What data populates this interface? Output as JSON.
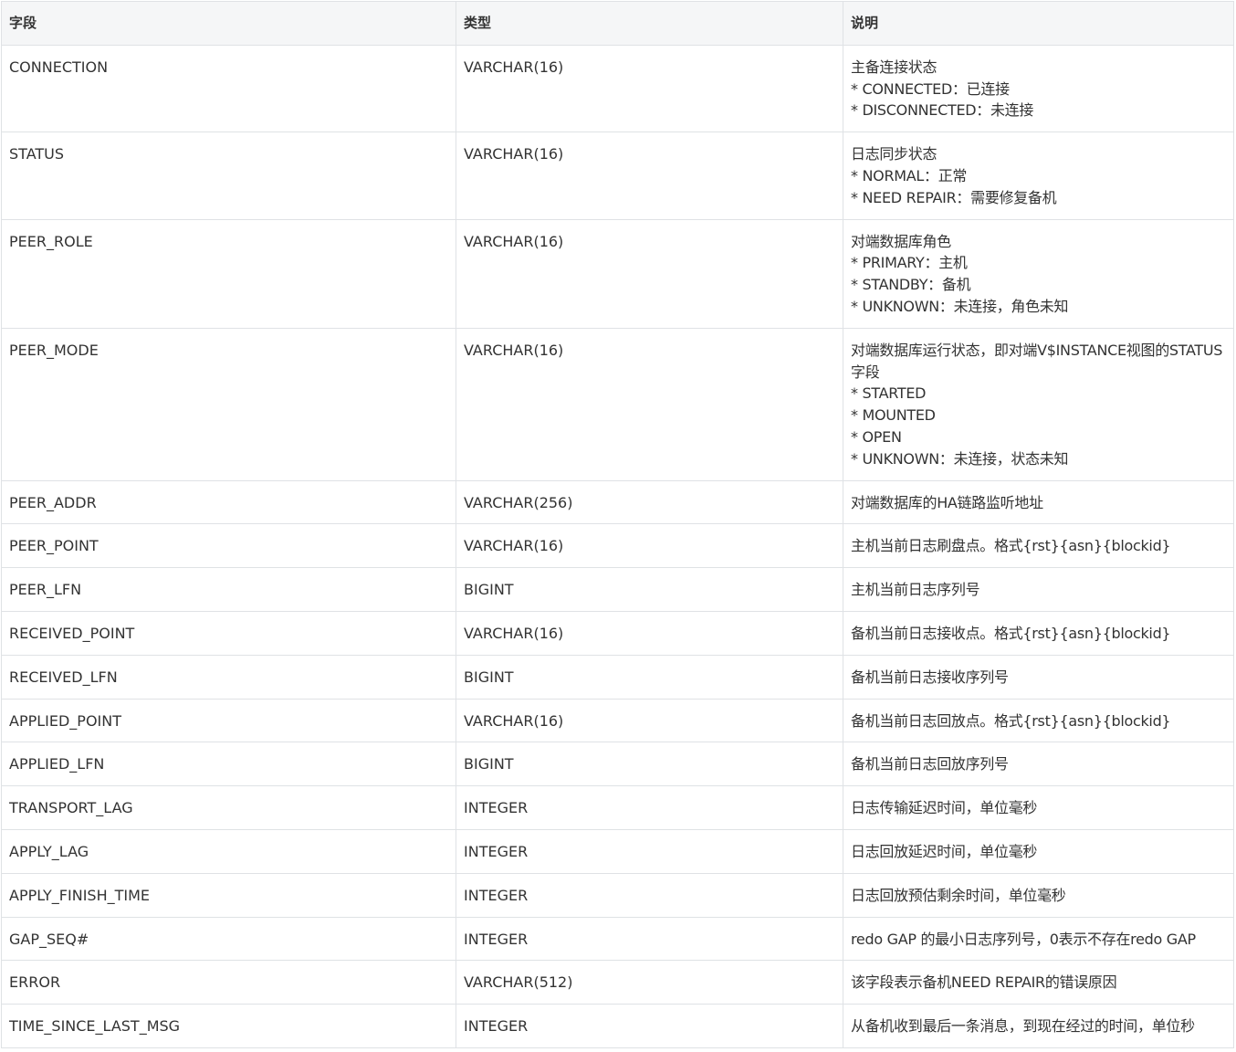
{
  "table": {
    "headers": [
      "字段",
      "类型",
      "说明"
    ],
    "rows": [
      {
        "field": "CONNECTION",
        "type": "VARCHAR(16)",
        "desc": [
          "主备连接状态",
          "* CONNECTED：已连接",
          "* DISCONNECTED：未连接"
        ]
      },
      {
        "field": "STATUS",
        "type": "VARCHAR(16)",
        "desc": [
          "日志同步状态",
          "* NORMAL：正常",
          "* NEED REPAIR：需要修复备机"
        ]
      },
      {
        "field": "PEER_ROLE",
        "type": "VARCHAR(16)",
        "desc": [
          "对端数据库角色",
          "* PRIMARY：主机",
          "* STANDBY：备机",
          "* UNKNOWN：未连接，角色未知"
        ]
      },
      {
        "field": "PEER_MODE",
        "type": "VARCHAR(16)",
        "desc": [
          "对端数据库运行状态，即对端V$INSTANCE视图的STATUS字段",
          "* STARTED",
          "* MOUNTED",
          "* OPEN",
          "* UNKNOWN：未连接，状态未知"
        ]
      },
      {
        "field": "PEER_ADDR",
        "type": "VARCHAR(256)",
        "desc": [
          "对端数据库的HA链路监听地址"
        ]
      },
      {
        "field": "PEER_POINT",
        "type": "VARCHAR(16)",
        "desc": [
          "主机当前日志刷盘点。格式{rst}{asn}{blockid}"
        ]
      },
      {
        "field": "PEER_LFN",
        "type": "BIGINT",
        "desc": [
          "主机当前日志序列号"
        ]
      },
      {
        "field": "RECEIVED_POINT",
        "type": "VARCHAR(16)",
        "desc": [
          "备机当前日志接收点。格式{rst}{asn}{blockid}"
        ]
      },
      {
        "field": "RECEIVED_LFN",
        "type": "BIGINT",
        "desc": [
          "备机当前日志接收序列号"
        ]
      },
      {
        "field": "APPLIED_POINT",
        "type": "VARCHAR(16)",
        "desc": [
          "备机当前日志回放点。格式{rst}{asn}{blockid}"
        ]
      },
      {
        "field": "APPLIED_LFN",
        "type": "BIGINT",
        "desc": [
          "备机当前日志回放序列号"
        ]
      },
      {
        "field": "TRANSPORT_LAG",
        "type": "INTEGER",
        "desc": [
          "日志传输延迟时间，单位毫秒"
        ]
      },
      {
        "field": "APPLY_LAG",
        "type": "INTEGER",
        "desc": [
          "日志回放延迟时间，单位毫秒"
        ]
      },
      {
        "field": "APPLY_FINISH_TIME",
        "type": "INTEGER",
        "desc": [
          "日志回放预估剩余时间，单位毫秒"
        ]
      },
      {
        "field": "GAP_SEQ#",
        "type": "INTEGER",
        "desc": [
          "redo GAP 的最小日志序列号，0表示不存在redo GAP"
        ]
      },
      {
        "field": "ERROR",
        "type": "VARCHAR(512)",
        "desc": [
          "该字段表示备机NEED REPAIR的错误原因"
        ]
      },
      {
        "field": "TIME_SINCE_LAST_MSG",
        "type": "INTEGER",
        "desc": [
          "从备机收到最后一条消息，到现在经过的时间，单位秒"
        ]
      }
    ]
  }
}
